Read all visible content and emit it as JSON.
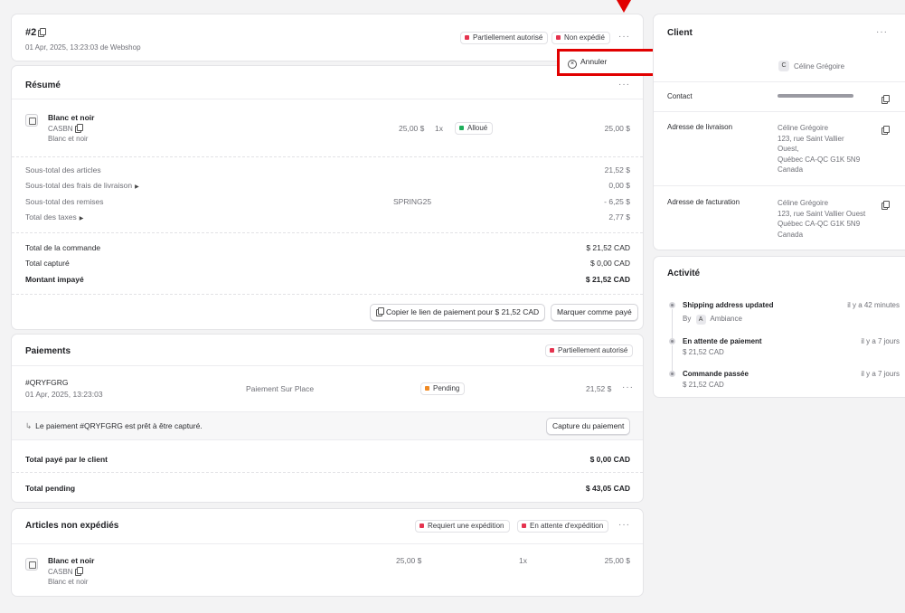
{
  "colors": {
    "red_annotation": "#e10000",
    "badge_red": "#e5334f",
    "badge_green": "#1fae5b",
    "badge_orange": "#f08a24"
  },
  "order": {
    "number": "#2",
    "meta": "01 Apr, 2025, 13:23:03 de Webshop",
    "badges": [
      "Partiellement autorisé",
      "Non expédié"
    ],
    "more": "···",
    "menu": {
      "cancel_label": "Annuler",
      "cancel_icon": "x-circle-icon"
    }
  },
  "summary": {
    "title": "Résumé",
    "item": {
      "name": "Blanc et noir",
      "sku": "CASBN",
      "variant": "Blanc et noir",
      "unit_price": "25,00 $",
      "qty": "1x",
      "status": "Alloué",
      "total": "25,00 $"
    },
    "lines": [
      {
        "label": "Sous-total des articles",
        "middle": "",
        "value": "21,52 $",
        "chevron": false
      },
      {
        "label": "Sous-total des frais de livraison",
        "middle": "",
        "value": "0,00 $",
        "chevron": true
      },
      {
        "label": "Sous-total des remises",
        "middle": "SPRING25",
        "value": "- 6,25 $",
        "chevron": false
      },
      {
        "label": "Total des taxes",
        "middle": "",
        "value": "2,77 $",
        "chevron": true
      }
    ],
    "totals": [
      {
        "label": "Total de la commande",
        "value": "$ 21,52 CAD",
        "bold": false
      },
      {
        "label": "Total capturé",
        "value": "$ 0,00 CAD",
        "bold": false
      },
      {
        "label": "Montant impayé",
        "value": "$ 21,52 CAD",
        "bold": true
      }
    ],
    "copy_link_label": "Copier le lien de paiement pour $ 21,52 CAD",
    "mark_paid_label": "Marquer comme payé"
  },
  "payments": {
    "title": "Paiements",
    "badge": "Partiellement autorisé",
    "row": {
      "id": "#QRYFGRG",
      "date": "01 Apr, 2025, 13:23:03",
      "method": "Paiement Sur Place",
      "status": "Pending",
      "amount": "21,52 $"
    },
    "notice": "Le paiement #QRYFGRG est prêt à être capturé.",
    "capture_label": "Capture du paiement",
    "paid_label": "Total payé par le client",
    "paid_value": "$ 0,00 CAD",
    "pending_label": "Total pending",
    "pending_value": "$ 43,05 CAD"
  },
  "unshipped": {
    "title": "Articles non expédiés",
    "badges": [
      "Requiert une expédition",
      "En attente d'expédition"
    ],
    "item": {
      "name": "Blanc et noir",
      "sku": "CASBN",
      "variant": "Blanc et noir",
      "unit_price": "25,00 $",
      "qty": "1x",
      "total": "25,00 $"
    }
  },
  "client": {
    "title": "Client",
    "avatar_letter": "C",
    "name": "Céline Grégoire",
    "contact_label": "Contact",
    "shipping_label": "Adresse de livraison",
    "shipping_lines": [
      "Céline Grégoire",
      "123, rue Saint Vallier",
      "Ouest,",
      "Québec CA-QC G1K 5N9",
      "Canada"
    ],
    "billing_label": "Adresse de facturation",
    "billing_lines": [
      "Céline Grégoire",
      "123, rue Saint Vallier Ouest",
      "Québec CA-QC G1K 5N9",
      "Canada"
    ]
  },
  "activity": {
    "title": "Activité",
    "events": [
      {
        "title": "Shipping address updated",
        "time": "il y a 42 minutes",
        "by_prefix": "By",
        "by_letter": "A",
        "by_name": "Ambiance"
      },
      {
        "title": "En attente de paiement",
        "time": "il y a 7 jours",
        "sub": "$ 21,52 CAD"
      },
      {
        "title": "Commande passée",
        "time": "il y a 7 jours",
        "sub": "$ 21,52 CAD"
      }
    ]
  }
}
